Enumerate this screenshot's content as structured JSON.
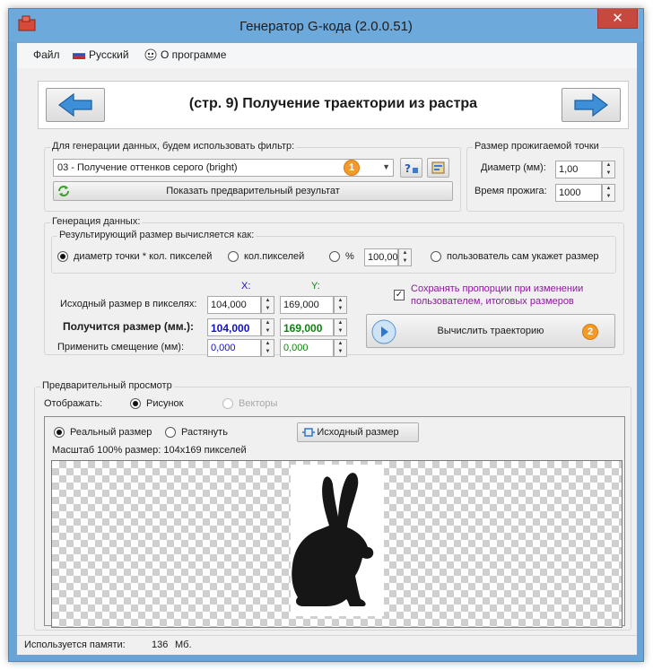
{
  "window": {
    "title": "Генератор G-кода (2.0.0.51)",
    "close": "✕"
  },
  "menu": {
    "file": "Файл",
    "language": "Русский",
    "about": "О программе"
  },
  "nav": {
    "title": "(стр. 9) Получение траектории из растра"
  },
  "filter": {
    "group_label": "Для генерации данных, будем использовать фильтр:",
    "selected": "03 - Получение оттенков серого (bright)",
    "preview_button": "Показать предварительный результат",
    "badge": "1"
  },
  "dot": {
    "group_label": "Размер прожигаемой точки",
    "diameter_label": "Диаметр (мм):",
    "diameter": "1,00",
    "burn_label": "Время прожига:",
    "burn": "1000"
  },
  "gen": {
    "group_label": "Генерация данных:",
    "result_label": "Результирующий размер вычисляется как:",
    "opt_dot": "диаметр точки * кол. пикселей",
    "opt_pixels": "кол.пикселей",
    "opt_percent": "%",
    "percent": "100,00",
    "opt_user": "пользователь сам укажет размер",
    "x_head": "X:",
    "y_head": "Y:",
    "orig_label": "Исходный размер в пикселях:",
    "orig_x": "104,000",
    "orig_y": "169,000",
    "result_size_label": "Получится размер (мм.):",
    "res_x": "104,000",
    "res_y": "169,000",
    "offset_label": "Применить смещение (мм):",
    "off_x": "0,000",
    "off_y": "0,000",
    "keep_ratio": "Сохранять пропорции при изменении пользователем, итоговых размеров",
    "calc_button": "Вычислить траекторию",
    "badge": "2"
  },
  "preview": {
    "group_label": "Предварительный просмотр",
    "show_label": "Отображать:",
    "opt_picture": "Рисунок",
    "opt_vectors": "Векторы",
    "opt_real": "Реальный размер",
    "opt_stretch": "Растянуть",
    "orig_size_button": "Исходный размер",
    "scale_text": "Масштаб 100% размер: 104x169 пикселей"
  },
  "status": {
    "memory_label": "Используется памяти:",
    "memory_value": "136",
    "memory_unit": "Мб."
  },
  "colors": {
    "blue_value": "#1010c0",
    "green_value": "#108010",
    "purple_text": "#8a1a9a",
    "badge": "#f39b2a",
    "title_bar": "#6ea9dc"
  }
}
